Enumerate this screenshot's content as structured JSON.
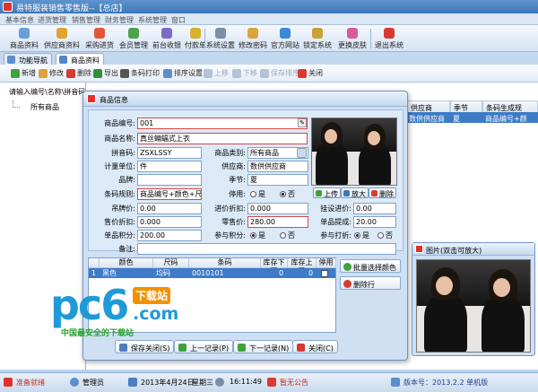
{
  "window": {
    "title": "易特服装销售零售版--【总店】"
  },
  "menu": [
    "基本信息",
    "进货管理",
    "销售管理",
    "财务管理",
    "系统管理",
    "窗口"
  ],
  "toolbar": [
    "商品资料",
    "供应商资料",
    "采购进货",
    "会员管理",
    "前台收银",
    "付款单",
    "系统设置",
    "修改密码",
    "官方网站",
    "锁定系统",
    "更换皮肤",
    "退出系统"
  ],
  "tabs": [
    "功能导航",
    "商品资料"
  ],
  "subtoolbar": [
    "新增",
    "修改",
    "删除",
    "导出",
    "条码打印",
    "排序设置",
    "上移",
    "下移",
    "保存排序",
    "关闭"
  ],
  "left": {
    "search_label": "请输入编号\\名称\\拼音码",
    "tree_root": "所有商品"
  },
  "table": {
    "headers": [
      "供应商",
      "季节",
      "条码生成规"
    ],
    "row": [
      "数供供应商",
      "夏",
      "商品编号+颜"
    ]
  },
  "dialog": {
    "title": "商品信息",
    "labels": {
      "code": "商品编号:",
      "name": "商品名称:",
      "pinyin": "拼音码:",
      "category": "商品类别:",
      "unit": "计量单位:",
      "supplier": "供应商:",
      "brand": "品牌:",
      "season": "季节:",
      "barcode_rule": "条码规则:",
      "disabled": "停用:",
      "tag_price": "吊牌价:",
      "cost_discount": "进价折扣:",
      "retail_price": "挂设进价:",
      "sale_discount": "售价折扣:",
      "sale_price": "零售价:",
      "commission": "单品提成:",
      "points": "单品积分:",
      "join_points": "参与积分:",
      "join_discount": "参与打折:",
      "remark": "备注:"
    },
    "values": {
      "code": "001",
      "name": "真丝蝙蝠式上衣",
      "pinyin": "ZSXLSSY",
      "category": "所有商品",
      "unit": "件",
      "supplier": "数供供应商",
      "brand": "",
      "season": "夏",
      "barcode_rule": "商品编号+颜色+尺码",
      "tag_price": "0.00",
      "cost_discount": "0.000",
      "retail_price": "0.00",
      "sale_discount": "0.000",
      "sale_price": "280.00",
      "commission": "20.00",
      "points": "200.00",
      "remark": ""
    },
    "radio": {
      "yes": "是",
      "no": "否"
    },
    "photo_buttons": [
      "上传",
      "放大",
      "删除"
    ],
    "grid_headers": [
      "颜色",
      "尺码",
      "条码",
      "库存下限",
      "库存上限",
      "停用"
    ],
    "grid_row": {
      "index": "1",
      "color": "黑色",
      "size": "均码",
      "barcode": "0010101",
      "min": "0",
      "max": "0"
    },
    "side_buttons": [
      "批量选择颜色",
      "删除行"
    ],
    "bottom_buttons": [
      "保存关闭(S)",
      "上一记录(P)",
      "下一记录(N)",
      "关闭(C)"
    ]
  },
  "image_window": {
    "title": "图片(双击可放大)"
  },
  "watermark": {
    "brand": "pc6",
    "download": "下载站",
    "domain": ".com",
    "slogan": "中国最安全的下载站"
  },
  "status": {
    "ready": "准备就绪",
    "user": "管理员",
    "date": "2013年4月24日",
    "weekday": "星期三",
    "time": "16:11:49",
    "notice": "暂无公告",
    "version": "版本号：2013.2.2 单机版"
  },
  "colors": {
    "accent": "#3d76b8",
    "red": "#e0312a",
    "watermark_blue": "#1f9ad6"
  }
}
